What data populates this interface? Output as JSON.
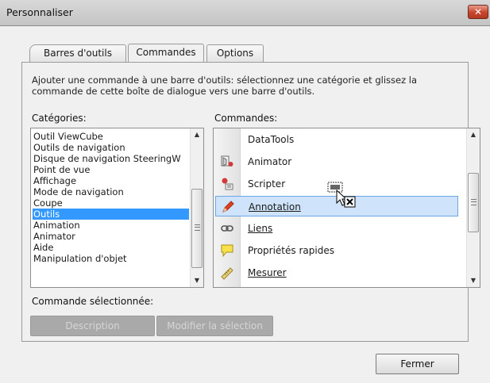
{
  "window": {
    "title": "Personnaliser",
    "close_glyph": "✕"
  },
  "tabs": [
    {
      "label": "Barres d'outils"
    },
    {
      "label": "Commandes"
    },
    {
      "label": "Options"
    }
  ],
  "active_tab": "Commandes",
  "description": "Ajouter une commande à une barre d'outils: sélectionnez une catégorie et glissez la commande de cette boîte de dialogue vers une barre d'outils.",
  "categories": {
    "label": "Catégories:",
    "items": [
      "Outil ViewCube",
      "Outils de navigation",
      "Disque de navigation SteeringW",
      "Point de vue",
      "Affichage",
      "Mode de navigation",
      "Coupe",
      "Outils",
      "Animation",
      "Animator",
      "Aide",
      "Manipulation d'objet"
    ],
    "selected": "Outils"
  },
  "commands": {
    "label": "Commandes:",
    "items": [
      {
        "label": "DataTools",
        "icon": "datatools-icon"
      },
      {
        "label": "Animator",
        "icon": "animator-icon"
      },
      {
        "label": "Scripter",
        "icon": "scripter-icon"
      },
      {
        "label": "Annotation",
        "icon": "annotation-pen-icon"
      },
      {
        "label": "Liens",
        "icon": "link-icon"
      },
      {
        "label": "Propriétés rapides",
        "icon": "quick-properties-icon"
      },
      {
        "label": "Mesurer",
        "icon": "measure-ruler-icon"
      }
    ],
    "selected": "Annotation"
  },
  "selected_command": {
    "label": "Commande sélectionnée:",
    "description_button": "Description",
    "modify_button": "Modifier la sélection"
  },
  "footer": {
    "close_button": "Fermer"
  },
  "colors": {
    "selection_blue": "#3399ff",
    "command_highlight": "#cfe4fa",
    "close_red": "#c8442c"
  }
}
